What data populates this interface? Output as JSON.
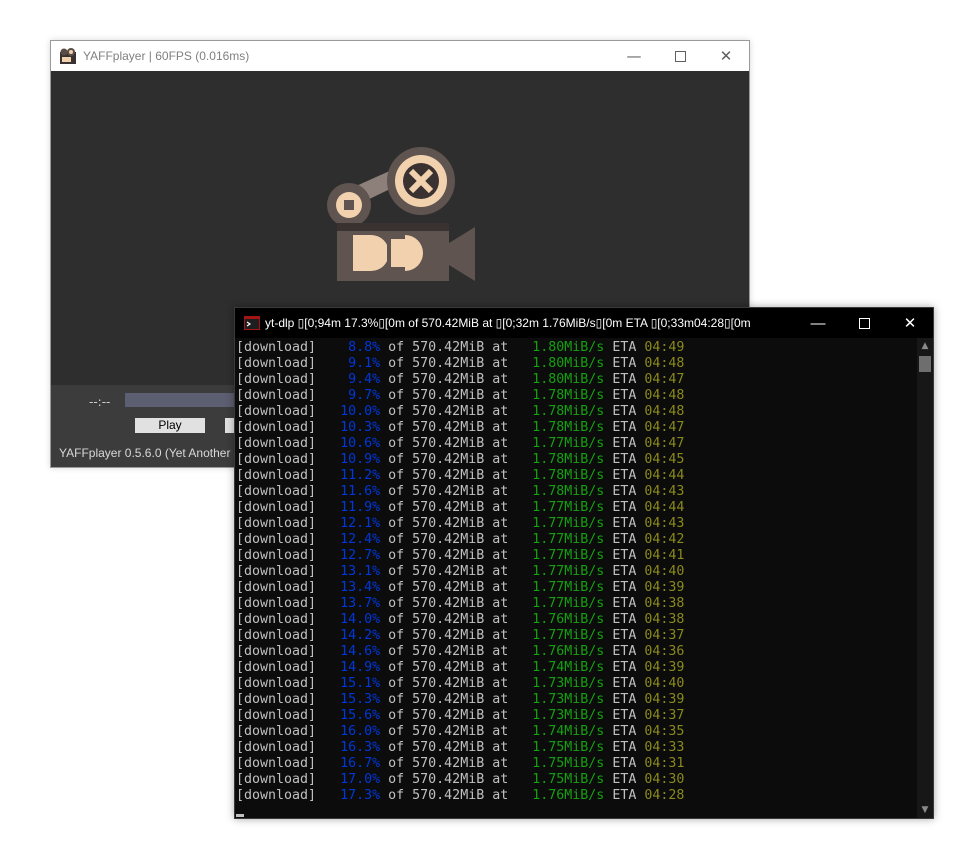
{
  "player": {
    "title": "YAFFplayer | 60FPS (0.016ms)",
    "time_label": "--:--",
    "play_label": "Play",
    "status_text": "YAFFplayer  0.5.6.0 (Yet Another"
  },
  "console": {
    "title": "yt-dlp ▯[0;94m 17.3%▯[0m of 570.42MiB at ▯[0;32m 1.76MiB/s▯[0m ETA ▯[0;33m04:28▯[0m",
    "lines": [
      {
        "tag": "[download]",
        "pct": "  8.8%",
        "size": "570.42MiB",
        "speed": "1.80MiB/s",
        "eta": "04:49"
      },
      {
        "tag": "[download]",
        "pct": "  9.1%",
        "size": "570.42MiB",
        "speed": "1.80MiB/s",
        "eta": "04:48"
      },
      {
        "tag": "[download]",
        "pct": "  9.4%",
        "size": "570.42MiB",
        "speed": "1.80MiB/s",
        "eta": "04:47"
      },
      {
        "tag": "[download]",
        "pct": "  9.7%",
        "size": "570.42MiB",
        "speed": "1.78MiB/s",
        "eta": "04:48"
      },
      {
        "tag": "[download]",
        "pct": " 10.0%",
        "size": "570.42MiB",
        "speed": "1.78MiB/s",
        "eta": "04:48"
      },
      {
        "tag": "[download]",
        "pct": " 10.3%",
        "size": "570.42MiB",
        "speed": "1.78MiB/s",
        "eta": "04:47"
      },
      {
        "tag": "[download]",
        "pct": " 10.6%",
        "size": "570.42MiB",
        "speed": "1.77MiB/s",
        "eta": "04:47"
      },
      {
        "tag": "[download]",
        "pct": " 10.9%",
        "size": "570.42MiB",
        "speed": "1.78MiB/s",
        "eta": "04:45"
      },
      {
        "tag": "[download]",
        "pct": " 11.2%",
        "size": "570.42MiB",
        "speed": "1.78MiB/s",
        "eta": "04:44"
      },
      {
        "tag": "[download]",
        "pct": " 11.6%",
        "size": "570.42MiB",
        "speed": "1.78MiB/s",
        "eta": "04:43"
      },
      {
        "tag": "[download]",
        "pct": " 11.9%",
        "size": "570.42MiB",
        "speed": "1.77MiB/s",
        "eta": "04:44"
      },
      {
        "tag": "[download]",
        "pct": " 12.1%",
        "size": "570.42MiB",
        "speed": "1.77MiB/s",
        "eta": "04:43"
      },
      {
        "tag": "[download]",
        "pct": " 12.4%",
        "size": "570.42MiB",
        "speed": "1.77MiB/s",
        "eta": "04:42"
      },
      {
        "tag": "[download]",
        "pct": " 12.7%",
        "size": "570.42MiB",
        "speed": "1.77MiB/s",
        "eta": "04:41"
      },
      {
        "tag": "[download]",
        "pct": " 13.1%",
        "size": "570.42MiB",
        "speed": "1.77MiB/s",
        "eta": "04:40"
      },
      {
        "tag": "[download]",
        "pct": " 13.4%",
        "size": "570.42MiB",
        "speed": "1.77MiB/s",
        "eta": "04:39"
      },
      {
        "tag": "[download]",
        "pct": " 13.7%",
        "size": "570.42MiB",
        "speed": "1.77MiB/s",
        "eta": "04:38"
      },
      {
        "tag": "[download]",
        "pct": " 14.0%",
        "size": "570.42MiB",
        "speed": "1.76MiB/s",
        "eta": "04:38"
      },
      {
        "tag": "[download]",
        "pct": " 14.2%",
        "size": "570.42MiB",
        "speed": "1.77MiB/s",
        "eta": "04:37"
      },
      {
        "tag": "[download]",
        "pct": " 14.6%",
        "size": "570.42MiB",
        "speed": "1.76MiB/s",
        "eta": "04:36"
      },
      {
        "tag": "[download]",
        "pct": " 14.9%",
        "size": "570.42MiB",
        "speed": "1.74MiB/s",
        "eta": "04:39"
      },
      {
        "tag": "[download]",
        "pct": " 15.1%",
        "size": "570.42MiB",
        "speed": "1.73MiB/s",
        "eta": "04:40"
      },
      {
        "tag": "[download]",
        "pct": " 15.3%",
        "size": "570.42MiB",
        "speed": "1.73MiB/s",
        "eta": "04:39"
      },
      {
        "tag": "[download]",
        "pct": " 15.6%",
        "size": "570.42MiB",
        "speed": "1.73MiB/s",
        "eta": "04:37"
      },
      {
        "tag": "[download]",
        "pct": " 16.0%",
        "size": "570.42MiB",
        "speed": "1.74MiB/s",
        "eta": "04:35"
      },
      {
        "tag": "[download]",
        "pct": " 16.3%",
        "size": "570.42MiB",
        "speed": "1.75MiB/s",
        "eta": "04:33"
      },
      {
        "tag": "[download]",
        "pct": " 16.7%",
        "size": "570.42MiB",
        "speed": "1.75MiB/s",
        "eta": "04:31"
      },
      {
        "tag": "[download]",
        "pct": " 17.0%",
        "size": "570.42MiB",
        "speed": "1.75MiB/s",
        "eta": "04:30"
      },
      {
        "tag": "[download]",
        "pct": " 17.3%",
        "size": "570.42MiB",
        "speed": "1.76MiB/s",
        "eta": "04:28"
      }
    ]
  },
  "colors": {
    "percent": "#0037da",
    "speed": "#13a10e",
    "eta": "#8a8a1c",
    "console_text": "#c0c0c0",
    "console_bg": "#0c0c0c",
    "player_bg": "#2e2e2e"
  },
  "icons": [
    "film-camera-logo-icon",
    "minimize-icon",
    "maximize-icon",
    "close-icon",
    "console-app-icon",
    "scroll-up-icon",
    "scroll-down-icon"
  ]
}
